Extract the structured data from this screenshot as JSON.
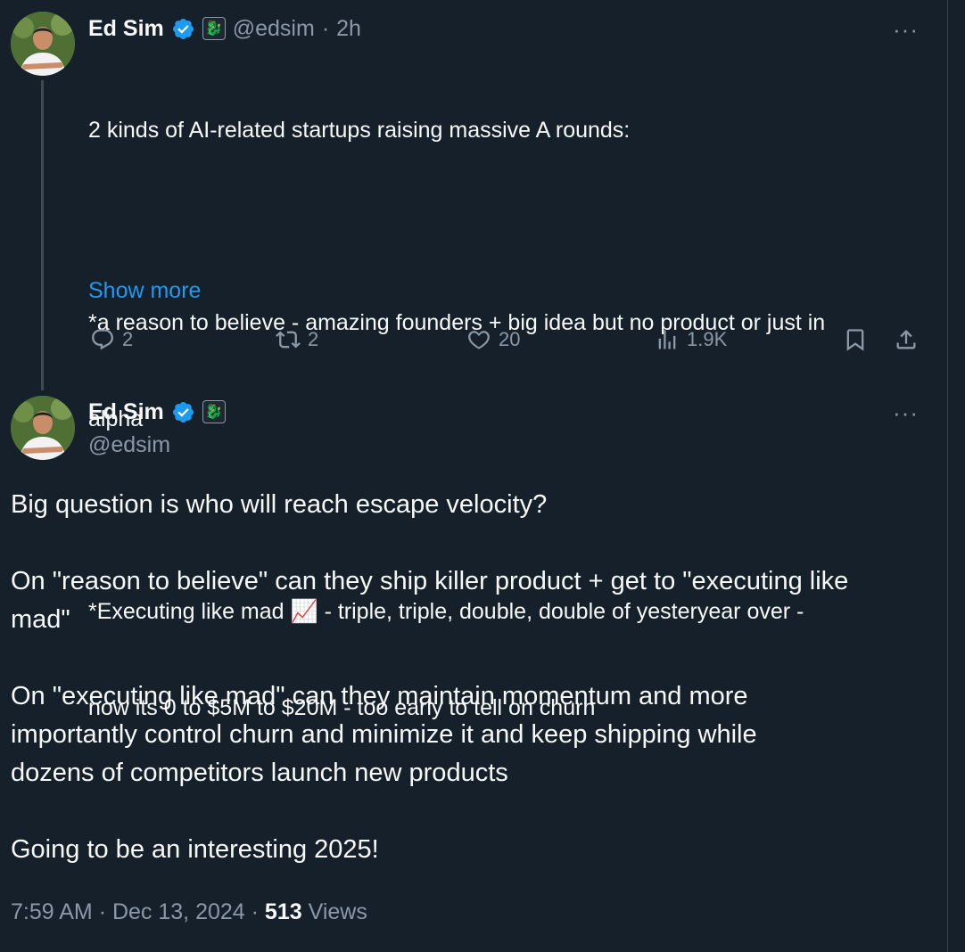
{
  "colors": {
    "background": "#15202b",
    "text": "#f7f9f9",
    "muted": "#8b98a5",
    "link": "#1d9bf0"
  },
  "tweet1": {
    "name": "Ed Sim",
    "handle": "@edsim",
    "separator": "·",
    "time": "2h",
    "more": "···",
    "lines": [
      "2 kinds of AI-related startups raising massive A rounds:",
      "",
      "*a reason to believe - amazing founders + big idea but no product or just in",
      "alpha",
      "",
      "*Executing like mad 📈 - triple, triple, double, double of yesteryear over -",
      "now its 0 to $5M to $20M - too early to tell on churn"
    ],
    "show_more": "Show more",
    "stats": {
      "replies": "2",
      "reposts": "2",
      "likes": "20",
      "views": "1.9K"
    }
  },
  "tweet2": {
    "name": "Ed Sim",
    "handle": "@edsim",
    "more": "···",
    "paragraphs": [
      [
        "Big question is who will reach escape velocity?"
      ],
      [
        "On \"reason to believe\" can they ship killer product + get to \"executing like",
        "mad\""
      ],
      [
        "On \"executing like mad\" can they maintain momentum and more",
        "importantly control churn and minimize it and keep shipping while",
        "dozens of competitors launch new products"
      ],
      [
        "Going to be an interesting 2025!"
      ]
    ],
    "time": "7:59 AM",
    "date": "Dec 13, 2024",
    "separator": "·",
    "views_count": "513",
    "views_label": "Views"
  },
  "icons": [
    "verified-badge-icon",
    "affiliate-badge-icon",
    "reply-icon",
    "repost-icon",
    "like-icon",
    "views-icon",
    "bookmark-icon",
    "share-icon",
    "more-icon"
  ]
}
